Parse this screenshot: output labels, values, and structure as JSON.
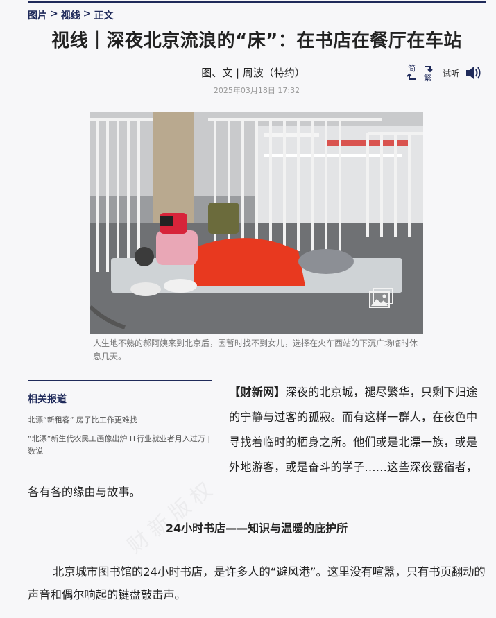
{
  "breadcrumb": {
    "home": "图片",
    "sep1": ">",
    "section": "视线",
    "sep2": ">",
    "current": "正文"
  },
  "article": {
    "title": "视线｜深夜北京流浪的“床”：在书店在餐厅在车站",
    "author": "图、文 | 周波（特约）",
    "date": "2025年03月18日 17:32"
  },
  "tools": {
    "convert_simplified": "简",
    "convert_traditional": "繁",
    "listen_label": "试听"
  },
  "photo": {
    "caption": "人生地不熟的郝阿姨来到北京后，因暂时找不到女儿，选择在火车西站的下沉广场临时休息几天。"
  },
  "related": {
    "heading": "相关报道",
    "items": [
      "北漂“新租客” 房子比工作更难找",
      "“北漂”新生代农民工画像出炉 IT行业就业者月入过万 | 数说"
    ]
  },
  "lead": {
    "source": "【财新网】",
    "text": "深夜的北京城，褪尽繁华，只剩下归途的宁静与过客的孤寂。而有这样一群人，在夜色中寻找着临时的栖身之所。他们或是北漂一族，或是外地游客，或是奋斗的学子……这些深夜露宿者，各有各的缘由与故事。"
  },
  "section1": {
    "heading": "24小时书店——知识与温暖的庇护所",
    "paragraph": "北京城市图书馆的24小时书店，是许多人的“避风港”。这里没有喧嚣，只有书页翻动的声音和偶尔响起的键盘敲击声。"
  },
  "watermark": "财新版权",
  "colors": {
    "accent": "#1f2a5a",
    "caption": "#777777",
    "date": "#999999"
  }
}
